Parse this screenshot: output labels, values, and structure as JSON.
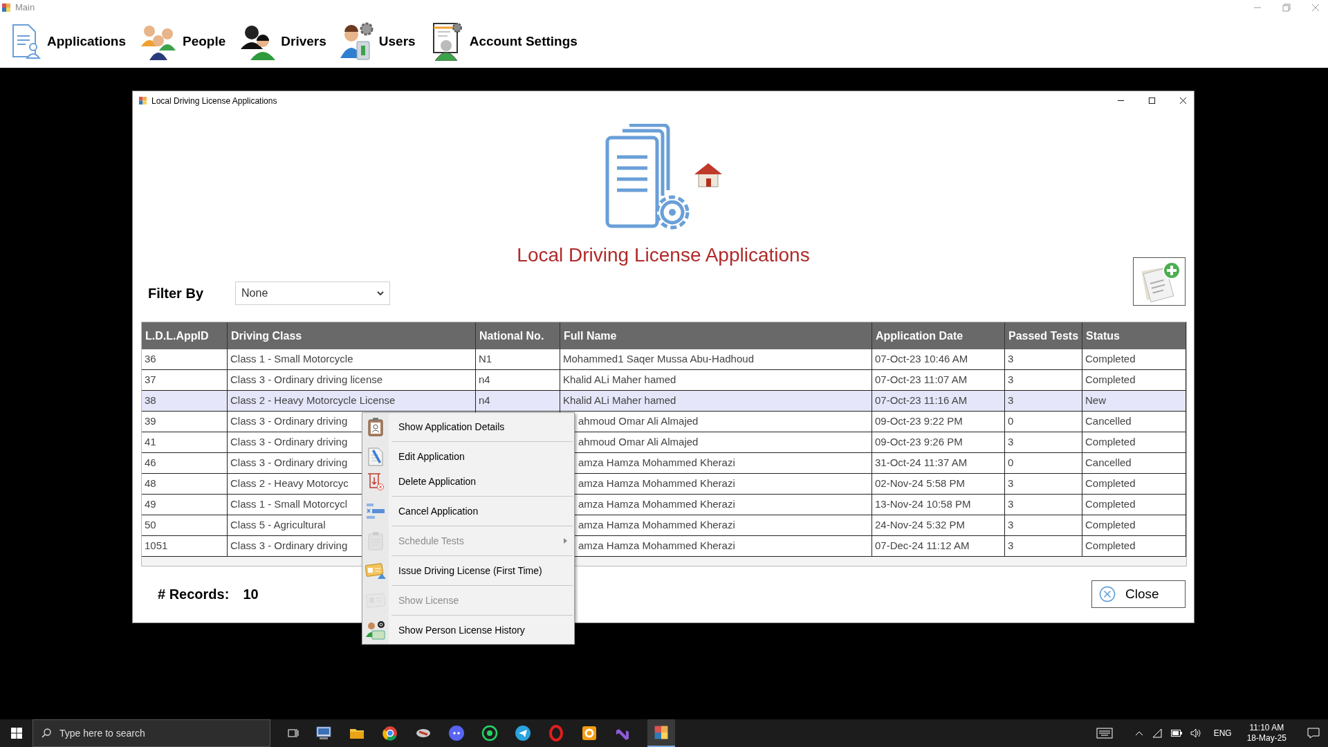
{
  "main_window": {
    "title": "Main"
  },
  "toolbar": [
    {
      "label": "Applications"
    },
    {
      "label": "People"
    },
    {
      "label": "Drivers"
    },
    {
      "label": "Users"
    },
    {
      "label": "Account Settings"
    }
  ],
  "dialog": {
    "title": "Local Driving License Applications",
    "heading": "Local Driving License Applications",
    "filter": {
      "label": "Filter By",
      "value": "None"
    },
    "table": {
      "columns": [
        "L.D.L.AppID",
        "Driving Class",
        "National No.",
        "Full Name",
        "Application Date",
        "Passed Tests",
        "Status"
      ],
      "rows": [
        {
          "id": "36",
          "driving_class": "Class 1 - Small Motorcycle",
          "national_no": "N1",
          "full_name": "Mohammed1 Saqer Mussa Abu-Hadhoud",
          "application_date": "07-Oct-23 10:46 AM",
          "passed_tests": "3",
          "status": "Completed",
          "selected": false
        },
        {
          "id": "37",
          "driving_class": "Class 3 - Ordinary driving license",
          "national_no": "n4",
          "full_name": "Khalid ALi Maher hamed",
          "application_date": "07-Oct-23 11:07 AM",
          "passed_tests": "3",
          "status": "Completed",
          "selected": false
        },
        {
          "id": "38",
          "driving_class": "Class 2 - Heavy Motorcycle License",
          "national_no": "n4",
          "full_name": "Khalid ALi Maher hamed",
          "application_date": "07-Oct-23 11:16 AM",
          "passed_tests": "3",
          "status": "New",
          "selected": true
        },
        {
          "id": "39",
          "driving_class": "Class 3 - Ordinary driving",
          "full_name": "ahmoud Omar Ali Almajed",
          "application_date": "09-Oct-23 9:22 PM",
          "passed_tests": "0",
          "status": "Cancelled",
          "selected": false
        },
        {
          "id": "41",
          "driving_class": "Class 3 - Ordinary driving",
          "full_name": "ahmoud Omar Ali Almajed",
          "application_date": "09-Oct-23 9:26 PM",
          "passed_tests": "3",
          "status": "Completed",
          "selected": false
        },
        {
          "id": "46",
          "driving_class": "Class 3 - Ordinary driving",
          "full_name": "amza Hamza Mohammed Kherazi",
          "application_date": "31-Oct-24 11:37 AM",
          "passed_tests": "0",
          "status": "Cancelled",
          "selected": false
        },
        {
          "id": "48",
          "driving_class": "Class 2 - Heavy Motorcyc",
          "full_name": "amza Hamza Mohammed Kherazi",
          "application_date": "02-Nov-24 5:58 PM",
          "passed_tests": "3",
          "status": "Completed",
          "selected": false
        },
        {
          "id": "49",
          "driving_class": "Class 1 - Small Motorcycl",
          "full_name": "amza Hamza Mohammed Kherazi",
          "application_date": "13-Nov-24 10:58 PM",
          "passed_tests": "3",
          "status": "Completed",
          "selected": false
        },
        {
          "id": "50",
          "driving_class": "Class 5 - Agricultural",
          "full_name": "amza Hamza Mohammed Kherazi",
          "application_date": "24-Nov-24 5:32 PM",
          "passed_tests": "3",
          "status": "Completed",
          "selected": false
        },
        {
          "id": "1051",
          "driving_class": "Class 3 - Ordinary driving",
          "full_name": "amza Hamza Mohammed Kherazi",
          "application_date": "07-Dec-24 11:12 AM",
          "passed_tests": "3",
          "status": "Completed",
          "selected": false
        }
      ]
    },
    "records": {
      "label": "# Records:",
      "value": "10"
    },
    "close_button": "Close"
  },
  "context_menu": {
    "items": [
      {
        "label": "Show Application Details",
        "disabled": false,
        "submenu": false,
        "separator_after": true
      },
      {
        "label": "Edit Application",
        "disabled": false,
        "submenu": false,
        "separator_after": false
      },
      {
        "label": "Delete Application",
        "disabled": false,
        "submenu": false,
        "separator_after": true
      },
      {
        "label": "Cancel Application",
        "disabled": false,
        "submenu": false,
        "separator_after": true
      },
      {
        "label": "Schedule Tests",
        "disabled": true,
        "submenu": true,
        "separator_after": true
      },
      {
        "label": "Issue Driving License (First Time)",
        "disabled": false,
        "submenu": false,
        "separator_after": true
      },
      {
        "label": "Show License",
        "disabled": true,
        "submenu": false,
        "separator_after": true
      },
      {
        "label": "Show Person License History",
        "disabled": false,
        "submenu": false,
        "separator_after": false
      }
    ]
  },
  "taskbar": {
    "search_placeholder": "Type here to search",
    "language": "ENG",
    "time": "11:10 AM",
    "date": "18-May-25"
  }
}
